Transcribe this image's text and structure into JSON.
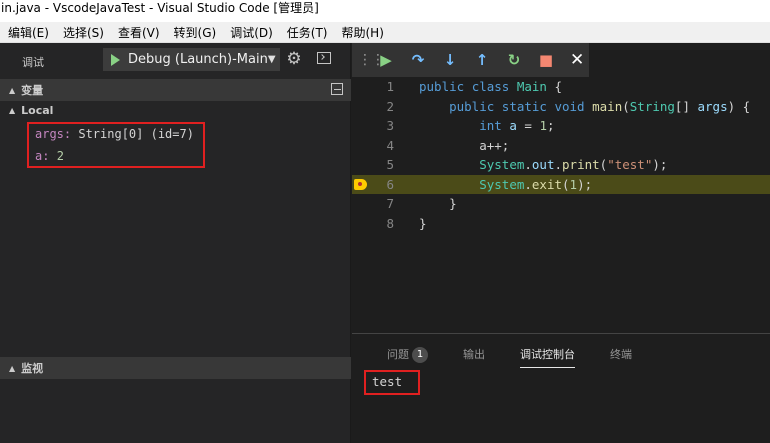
{
  "window": {
    "title": "in.java - VscodeJavaTest - Visual Studio Code [管理员]"
  },
  "menu": {
    "items": [
      "编辑(E)",
      "选择(S)",
      "查看(V)",
      "转到(G)",
      "调试(D)",
      "任务(T)",
      "帮助(H)"
    ]
  },
  "sidebar": {
    "title": "调试",
    "config": "Debug (Launch)-Main",
    "sections": {
      "variables": "变量",
      "local": "Local",
      "watch": "监视"
    },
    "vars": [
      {
        "name": "args:",
        "value": "String[0] (id=7)"
      },
      {
        "name": "a:",
        "value": "2"
      }
    ]
  },
  "editor": {
    "lines": [
      {
        "n": "1",
        "tokens": [
          [
            "kw",
            "public "
          ],
          [
            "kw",
            "class "
          ],
          [
            "cls",
            "Main"
          ],
          [
            "plain",
            " {"
          ]
        ]
      },
      {
        "n": "2",
        "tokens": [
          [
            "plain",
            "    "
          ],
          [
            "kw",
            "public "
          ],
          [
            "kw",
            "static "
          ],
          [
            "kw",
            "void "
          ],
          [
            "fn",
            "main"
          ],
          [
            "plain",
            "("
          ],
          [
            "cls",
            "String"
          ],
          [
            "plain",
            "[] "
          ],
          [
            "var",
            "args"
          ],
          [
            "plain",
            ") {"
          ]
        ]
      },
      {
        "n": "3",
        "tokens": [
          [
            "plain",
            "        "
          ],
          [
            "kw",
            "int "
          ],
          [
            "var",
            "a"
          ],
          [
            "plain",
            " = "
          ],
          [
            "num",
            "1"
          ],
          [
            "plain",
            ";"
          ]
        ]
      },
      {
        "n": "4",
        "tokens": [
          [
            "plain",
            "        a++;"
          ]
        ]
      },
      {
        "n": "5",
        "tokens": [
          [
            "plain",
            "        "
          ],
          [
            "cls",
            "System"
          ],
          [
            "plain",
            "."
          ],
          [
            "var",
            "out"
          ],
          [
            "plain",
            "."
          ],
          [
            "fn",
            "print"
          ],
          [
            "plain",
            "("
          ],
          [
            "str",
            "\"test\""
          ],
          [
            "plain",
            ");"
          ]
        ]
      },
      {
        "n": "6",
        "tokens": [
          [
            "plain",
            "        "
          ],
          [
            "cls",
            "System"
          ],
          [
            "plain",
            "."
          ],
          [
            "fn",
            "exit"
          ],
          [
            "plain",
            "("
          ],
          [
            "num",
            "1"
          ],
          [
            "plain",
            ");"
          ]
        ],
        "highlight": true
      },
      {
        "n": "7",
        "tokens": [
          [
            "plain",
            "    }"
          ]
        ]
      },
      {
        "n": "8",
        "tokens": [
          [
            "plain",
            "}"
          ]
        ]
      }
    ]
  },
  "panel": {
    "tabs": [
      {
        "label": "问题",
        "badge": "1"
      },
      {
        "label": "输出"
      },
      {
        "label": "调试控制台",
        "active": true
      },
      {
        "label": "终端"
      }
    ],
    "console_output": "test"
  },
  "colors": {
    "accent": "#e02020",
    "continue": "#89d185",
    "step": "#75beff",
    "stop": "#f48771"
  }
}
